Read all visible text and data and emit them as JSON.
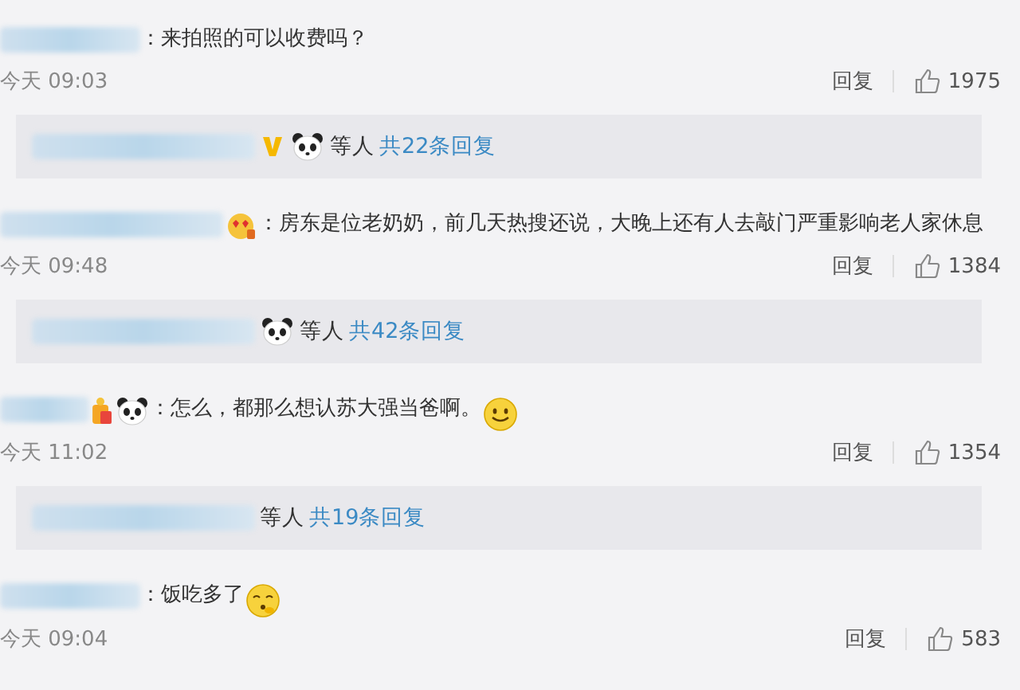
{
  "comments": [
    {
      "text": "：来拍照的可以收费吗？",
      "time": "今天 09:03",
      "reply_label": "回复",
      "likes": "1975",
      "replies": {
        "icons": [
          {
            "kind": "v"
          },
          {
            "kind": "panda"
          }
        ],
        "others": "等人",
        "count": "共22条回复"
      }
    },
    {
      "badges": [
        {
          "kind": "love"
        }
      ],
      "text": "：房东是位老奶奶，前几天热搜还说，大晚上还有人去敲门严重影响老人家休息",
      "time": "今天 09:48",
      "reply_label": "回复",
      "likes": "1384",
      "replies": {
        "icons": [
          {
            "kind": "panda"
          }
        ],
        "others": "等人",
        "count": "共42条回复"
      }
    },
    {
      "badges": [
        {
          "kind": "gift"
        },
        {
          "kind": "panda"
        }
      ],
      "text": "：怎么，都那么想认苏大强当爸啊。",
      "end_emoji": {
        "kind": "smile"
      },
      "time": "今天 11:02",
      "reply_label": "回复",
      "likes": "1354",
      "replies": {
        "others": "等人",
        "count": "共19条回复"
      }
    },
    {
      "text": "：饭吃多了",
      "end_emoji": {
        "kind": "shy"
      },
      "time": "今天 09:04",
      "reply_label": "回复",
      "likes": "583"
    }
  ]
}
